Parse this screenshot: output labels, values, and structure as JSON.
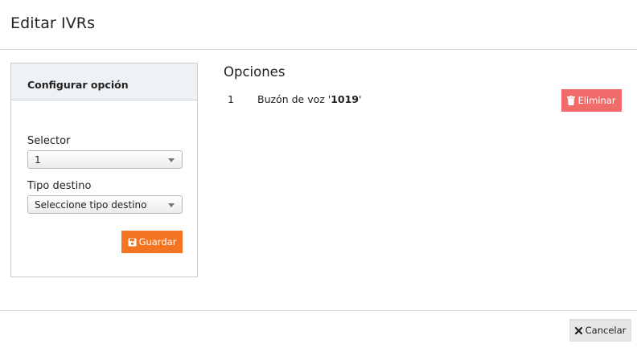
{
  "modal": {
    "title": "Editar IVRs"
  },
  "config_panel": {
    "title": "Configurar opción",
    "selector": {
      "label": "Selector",
      "value": "1"
    },
    "tipo_destino": {
      "label": "Tipo destino",
      "value": "Seleccione tipo destino"
    },
    "save_button": {
      "label": "Guardar",
      "icon": "floppy-disk-icon"
    }
  },
  "options_section": {
    "title": "Opciones",
    "items": [
      {
        "number": "1",
        "text_prefix": "Buzón de voz '",
        "text_bold": "1019",
        "text_suffix": "'",
        "delete_label": "Eliminar",
        "delete_icon": "trash-icon"
      }
    ]
  },
  "footer": {
    "cancel_label": "Cancelar",
    "cancel_icon": "close-x-icon"
  },
  "colors": {
    "save": "#f47422",
    "delete": "#f16b6b",
    "cancel": "#e6e6e6",
    "panel_header": "#eef2f5"
  }
}
